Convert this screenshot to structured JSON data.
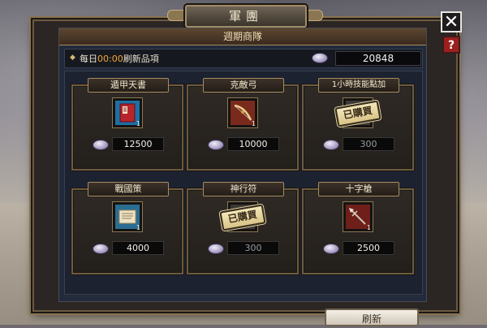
{
  "window": {
    "title": "軍團"
  },
  "panel": {
    "header": "週期商隊",
    "info": {
      "prefix": "每日",
      "time": "00:00",
      "suffix": "刷新品項"
    },
    "balance": "20848"
  },
  "items": [
    {
      "label": "遁甲天書",
      "price": "12500",
      "qty": "1",
      "sold": false,
      "icon": "book-icon"
    },
    {
      "label": "克敵弓",
      "price": "10000",
      "qty": "1",
      "sold": false,
      "icon": "bow-icon"
    },
    {
      "label": "1小時技能點加",
      "price": "300",
      "qty": "",
      "sold": true,
      "icon": "skill-scroll-icon"
    },
    {
      "label": "戰國策",
      "price": "4000",
      "qty": "1",
      "sold": false,
      "icon": "scroll-icon"
    },
    {
      "label": "神行符",
      "price": "300",
      "qty": "",
      "sold": true,
      "icon": "talisman-icon"
    },
    {
      "label": "十字槍",
      "price": "2500",
      "qty": "1",
      "sold": false,
      "icon": "spear-icon"
    }
  ],
  "sold_stamp": "已購買",
  "buttons": {
    "refresh": "刷新",
    "close": "✕",
    "help": "?"
  },
  "colors": {
    "accent": "#f2a83a",
    "frame": "#8a7450",
    "panel": "#222b3c"
  }
}
